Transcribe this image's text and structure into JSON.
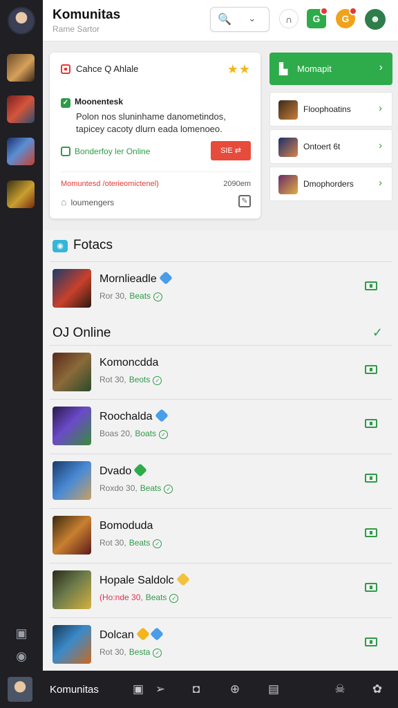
{
  "header": {
    "title": "Komunitas",
    "subtitle": "Rame Sartor"
  },
  "colors": {
    "accent_green": "#2eab4a",
    "accent_red": "#e53935",
    "rail_dark": "#1f1f24",
    "star_gold": "#f2b51c"
  },
  "featured": {
    "header": "Cahce Q Ahlale",
    "rating_stars": "★★",
    "title": "Moonentesk",
    "description": "Polon nos sluninhame danometindos, tapicey cacoty dlurn eada lomenoeo.",
    "status": "Bonderfoy ler Online",
    "button_label": "SIE ⇄",
    "notice": "Momuntesd /oterieomictenel)",
    "time": "2090em",
    "footer_label": "loumengers"
  },
  "sidepanel": {
    "primary_label": "Momapit",
    "items": [
      {
        "label": "Floophoatins"
      },
      {
        "label": "Ontoert 6t"
      },
      {
        "label": "Dmophorders"
      }
    ]
  },
  "sections": {
    "favorites_title": "Fotacs",
    "online_title": "OJ Online"
  },
  "favorites": [
    {
      "name": "Mornlieadle",
      "meta": "Ror 30,",
      "tag": "Beats"
    }
  ],
  "online": [
    {
      "name": "Komoncdda",
      "meta": "Rot 30,",
      "tag": "Beots"
    },
    {
      "name": "Roochalda",
      "meta": "Boas 20,",
      "tag": "Boats"
    },
    {
      "name": "Dvado",
      "meta": "Roxdo 30,",
      "tag": "Beats"
    },
    {
      "name": "Bomoduda",
      "meta": "Rot 30,",
      "tag": "Beats"
    },
    {
      "name": "Hopale Saldolc",
      "meta": "(Ho:nde 30,",
      "tag": "Beats"
    },
    {
      "name": "Dolcan",
      "meta": "Rot 30,",
      "tag": "Besta"
    }
  ],
  "bottombar": {
    "label": "Komunitas"
  },
  "icons": {
    "search": "search-icon",
    "dropdown": "chevron-down-icon",
    "headset": "headset-icon",
    "chat": "chat-icon",
    "notifications": "notification-icon"
  }
}
